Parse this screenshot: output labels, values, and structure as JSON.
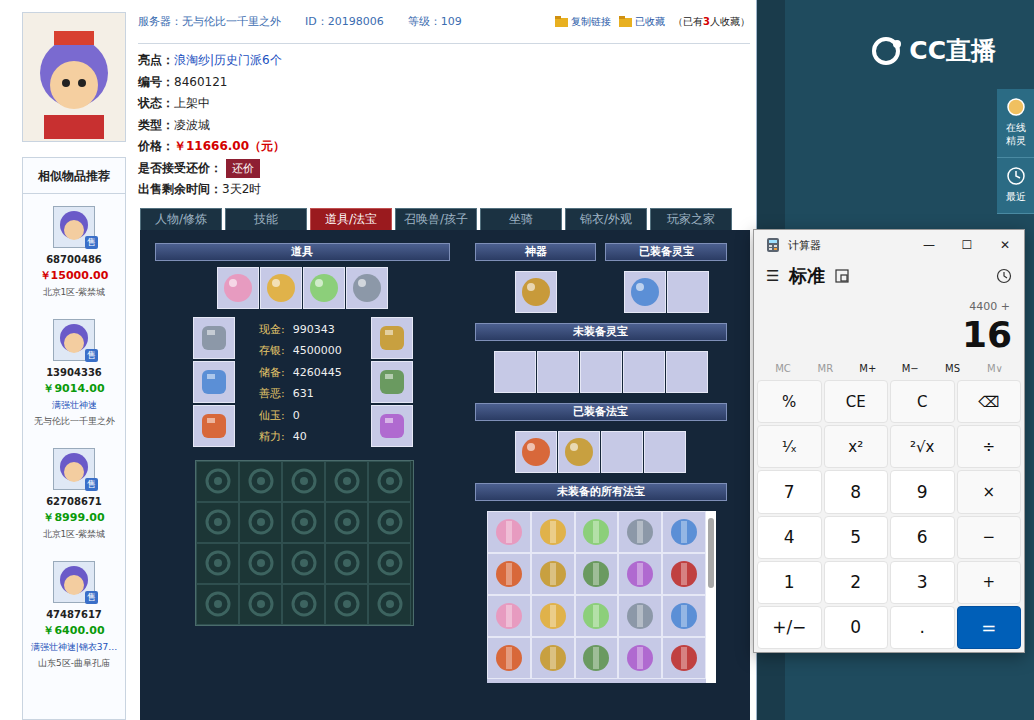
{
  "header": {
    "server": "服务器：无与伦比一千里之外",
    "id": "ID：20198006",
    "level": "等级：109",
    "links": [
      {
        "label": "复制链接"
      },
      {
        "label": "已收藏"
      }
    ],
    "favorites": {
      "prefix": "（已有",
      "count": "3",
      "suffix": "人收藏）"
    }
  },
  "info": [
    {
      "label": "亮点：",
      "value": "浪淘纱|历史门派6个",
      "kind": "link"
    },
    {
      "label": "编号：",
      "value": "8460121",
      "kind": "text"
    },
    {
      "label": "状态：",
      "value": "上架中",
      "kind": "text"
    },
    {
      "label": "类型：",
      "value": "凌波城",
      "kind": "text"
    },
    {
      "label": "价格：",
      "value": "￥11666.00（元）",
      "kind": "price"
    },
    {
      "label": "是否接受还价：",
      "value": "还价",
      "kind": "button"
    },
    {
      "label": "出售剩余时间：",
      "value": "3天2时",
      "kind": "text"
    }
  ],
  "tabs": [
    {
      "label": "人物/修炼",
      "selected": false
    },
    {
      "label": "技能",
      "selected": false
    },
    {
      "label": "道具/法宝",
      "selected": true
    },
    {
      "label": "召唤兽/孩子",
      "selected": false
    },
    {
      "label": "坐骑",
      "selected": false
    },
    {
      "label": "锦衣/外观",
      "selected": false
    },
    {
      "label": "玩家之家",
      "selected": false
    }
  ],
  "props": {
    "title": "道具",
    "top_items": [
      {
        "filled": true
      },
      {
        "filled": true
      },
      {
        "filled": true
      },
      {
        "filled": true
      }
    ],
    "left_equipment": [
      {
        "filled": true
      },
      {
        "filled": true
      },
      {
        "filled": true
      }
    ],
    "right_equipment": [
      {
        "filled": true
      },
      {
        "filled": true
      },
      {
        "filled": true
      }
    ],
    "stats": [
      {
        "label": "现金:",
        "value": "990343"
      },
      {
        "label": "存银:",
        "value": "4500000"
      },
      {
        "label": "储备:",
        "value": "4260445"
      },
      {
        "label": "善恶:",
        "value": "631"
      },
      {
        "label": "仙玉:",
        "value": "0"
      },
      {
        "label": "精力:",
        "value": "40"
      }
    ],
    "inventory": [
      {
        "filled": false
      },
      {
        "filled": false
      },
      {
        "filled": false
      },
      {
        "filled": false
      },
      {
        "filled": false
      },
      {
        "filled": false
      },
      {
        "filled": false
      },
      {
        "filled": false
      },
      {
        "filled": false
      },
      {
        "filled": false
      },
      {
        "filled": false
      },
      {
        "filled": false
      },
      {
        "filled": false
      },
      {
        "filled": false
      },
      {
        "filled": false
      },
      {
        "filled": false
      },
      {
        "filled": false
      },
      {
        "filled": false
      },
      {
        "filled": false
      },
      {
        "filled": false
      }
    ]
  },
  "artifact": {
    "title": "神器",
    "slots": [
      {
        "filled": true
      }
    ]
  },
  "equipped_lingbao": {
    "title": "已装备灵宝",
    "slots": [
      {
        "filled": true
      },
      {
        "filled": false
      }
    ]
  },
  "unequipped_lingbao": {
    "title": "未装备灵宝",
    "slots": [
      {
        "filled": false
      },
      {
        "filled": false
      },
      {
        "filled": false
      },
      {
        "filled": false
      },
      {
        "filled": false
      }
    ]
  },
  "equipped_fabao": {
    "title": "已装备法宝",
    "slots": [
      {
        "filled": true
      },
      {
        "filled": true
      },
      {
        "filled": false
      },
      {
        "filled": false
      }
    ]
  },
  "unequipped_fabao": {
    "title": "未装备的所有法宝",
    "scroll_level": 0.45,
    "slots": [
      {
        "filled": true
      },
      {
        "filled": true
      },
      {
        "filled": true
      },
      {
        "filled": true
      },
      {
        "filled": true
      },
      {
        "filled": true
      },
      {
        "filled": true
      },
      {
        "filled": true
      },
      {
        "filled": true
      },
      {
        "filled": true
      },
      {
        "filled": true
      },
      {
        "filled": true
      },
      {
        "filled": true
      },
      {
        "filled": true
      },
      {
        "filled": true
      },
      {
        "filled": true
      },
      {
        "filled": true
      },
      {
        "filled": true
      },
      {
        "filled": true
      },
      {
        "filled": true
      }
    ]
  },
  "sidebar": {
    "title": "相似物品推荐",
    "items": [
      {
        "id": "68700486",
        "price": "￥15000.00",
        "color": "#d40000",
        "server": "北京1区-紫禁城",
        "badge": "售"
      },
      {
        "id": "13904336",
        "price": "￥9014.00",
        "color": "#0a9a0a",
        "tag": "满强壮神速",
        "server": "无与伦比一千里之外",
        "badge": "售"
      },
      {
        "id": "62708671",
        "price": "￥8999.00",
        "color": "#0a9a0a",
        "server": "北京1区-紫禁城",
        "badge": "售"
      },
      {
        "id": "47487617",
        "price": "￥6400.00",
        "color": "#0a9a0a",
        "tag": "满强壮神速|锦衣37…",
        "server": "山东5区-曲阜孔庙",
        "badge": "售"
      }
    ]
  },
  "right_panel": {
    "logo": "CC直播",
    "side_buttons": [
      {
        "label": "在线精灵"
      },
      {
        "label": "最近"
      }
    ]
  },
  "calculator": {
    "title": "计算器",
    "controls": [
      "—",
      "☐",
      "✕"
    ],
    "menu": "☰",
    "mode": "标准",
    "expression": "4400 +",
    "display": "16",
    "memory": [
      {
        "label": "MC",
        "disabled": true
      },
      {
        "label": "MR",
        "disabled": true
      },
      {
        "label": "M+",
        "disabled": false
      },
      {
        "label": "M−",
        "disabled": false
      },
      {
        "label": "MS",
        "disabled": false
      },
      {
        "label": "M∨",
        "disabled": true
      }
    ],
    "keys": [
      {
        "label": "%",
        "kind": "op"
      },
      {
        "label": "CE",
        "kind": "op"
      },
      {
        "label": "C",
        "kind": "op"
      },
      {
        "label": "⌫",
        "kind": "op"
      },
      {
        "label": "¹⁄ₓ",
        "kind": "op"
      },
      {
        "label": "x²",
        "kind": "op"
      },
      {
        "label": "²√x",
        "kind": "op"
      },
      {
        "label": "÷",
        "kind": "op"
      },
      {
        "label": "7",
        "kind": "num"
      },
      {
        "label": "8",
        "kind": "num"
      },
      {
        "label": "9",
        "kind": "num"
      },
      {
        "label": "×",
        "kind": "op"
      },
      {
        "label": "4",
        "kind": "num"
      },
      {
        "label": "5",
        "kind": "num"
      },
      {
        "label": "6",
        "kind": "num"
      },
      {
        "label": "−",
        "kind": "op"
      },
      {
        "label": "1",
        "kind": "num"
      },
      {
        "label": "2",
        "kind": "num"
      },
      {
        "label": "3",
        "kind": "num"
      },
      {
        "label": "+",
        "kind": "op"
      },
      {
        "label": "+/−",
        "kind": "num"
      },
      {
        "label": "0",
        "kind": "num"
      },
      {
        "label": ".",
        "kind": "num"
      },
      {
        "label": "=",
        "kind": "equals"
      }
    ]
  }
}
